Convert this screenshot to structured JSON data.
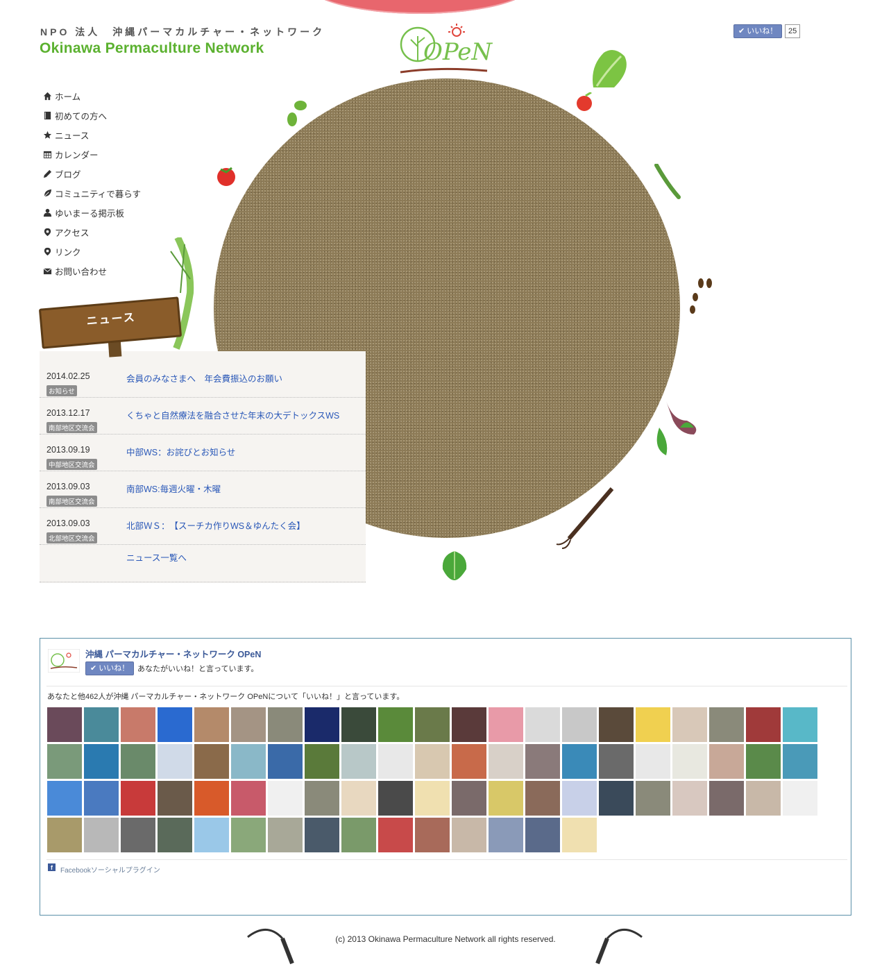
{
  "header": {
    "org_jp": "NPO 法人　沖縄パーマカルチャー・ネットワーク",
    "org_en": "Okinawa Permaculture Network",
    "logo_text": "OPeN"
  },
  "like_widget": {
    "label": "✔ いいね！",
    "count": "25"
  },
  "nav": {
    "items": [
      {
        "label": "ホーム",
        "icon": "home-icon"
      },
      {
        "label": "初めての方へ",
        "icon": "book-icon"
      },
      {
        "label": "ニュース",
        "icon": "star-icon"
      },
      {
        "label": "カレンダー",
        "icon": "calendar-icon"
      },
      {
        "label": "ブログ",
        "icon": "pencil-icon"
      },
      {
        "label": "コミュニティで暮らす",
        "icon": "leaf-icon"
      },
      {
        "label": "ゆいまーる掲示板",
        "icon": "user-icon"
      },
      {
        "label": "アクセス",
        "icon": "map-marker-icon"
      },
      {
        "label": "リンク",
        "icon": "map-marker-icon"
      },
      {
        "label": "お問い合わせ",
        "icon": "envelope-icon"
      }
    ]
  },
  "news": {
    "heading": "ニュース",
    "items": [
      {
        "date": "2014.02.25",
        "tag": "お知らせ",
        "title": "会員のみなさまへ　年会費振込のお願い"
      },
      {
        "date": "2013.12.17",
        "tag": "南部地区交流会",
        "title": "くちゃと自然療法を融合させた年末の大デトックスWS"
      },
      {
        "date": "2013.09.19",
        "tag": "中部地区交流会",
        "title": "中部WS：お詫びとお知らせ"
      },
      {
        "date": "2013.09.03",
        "tag": "南部地区交流会",
        "title": "南部WS:毎週火曜・木曜"
      },
      {
        "date": "2013.09.03",
        "tag": "北部地区交流会",
        "title": "北部ＷＳ：　【スーチカ作りWS＆ゆんたく会】"
      }
    ],
    "more_link": "ニュース一覧へ"
  },
  "facebook": {
    "page_name": "沖縄 パーマカルチャー・ネットワーク OPeN",
    "like_button": "✔ いいね！",
    "you_like": "あなたがいいね！と言っています。",
    "count_text": "あなたと他462人が沖縄 パーマカルチャー・ネットワーク OPeNについて「いいね！」と言っています。",
    "plugin_label": "Facebookソーシャルプラグイン",
    "plugin_icon": "facebook-icon",
    "faces": [
      "#6a4a5a",
      "#4a8a9a",
      "#c87a6a",
      "#2a6ad0",
      "#b48a6a",
      "#a49484",
      "#8a8a7a",
      "#1a2a6a",
      "#3a4a3a",
      "#5a8a3a",
      "#6a7a4a",
      "#5a3a3a",
      "#e89aa8",
      "#dadada",
      "#c8c8c8",
      "#5a4a3a",
      "#f0d050",
      "#d8c8b8",
      "#8a8a7a",
      "#a03a3a",
      "#58b8c8",
      "#7a9a7a",
      "#2a7ab0",
      "#6a8a6a",
      "#d0dae8",
      "#8a6a4a",
      "#8ab8c8",
      "#3a6aa8",
      "#5a7a3a",
      "#b8c8c8",
      "#e8e8e8",
      "#d8c8b0",
      "#c86a4a",
      "#d8d0c8",
      "#8a7a7a",
      "#3a8ab8",
      "#6a6a6a",
      "#e8e8e8",
      "#e8e8e0",
      "#c8a898",
      "#5a8a4a",
      "#4a9ab8",
      "#4a8ad8",
      "#4a7ac0",
      "#c83a3a",
      "#6a5a4a",
      "#d85a2a",
      "#c85a6a",
      "#f0f0f0",
      "#8a8a7a",
      "#e8d8c0",
      "#4a4a4a",
      "#f0e0b0",
      "#7a6a6a",
      "#d8c868",
      "#8a6a5a",
      "#c8d0e8",
      "#3a4a5a",
      "#8a8a7a",
      "#d8c8c0",
      "#7a6a6a",
      "#c8b8a8",
      "#f0f0f0",
      "#a89a6a",
      "#b8b8b8",
      "#6a6a6a",
      "#5a6a5a",
      "#9ac8e8",
      "#8aa87a",
      "#a8a898",
      "#4a5a6a",
      "#7a9a6a",
      "#c84a4a",
      "#a86a5a",
      "#c8b8a8",
      "#8a9ab8",
      "#5a6a8a",
      "#f0e0b0"
    ]
  },
  "footer": {
    "copyright": "(c) 2013 Okinawa Permaculture Network all rights reserved."
  }
}
